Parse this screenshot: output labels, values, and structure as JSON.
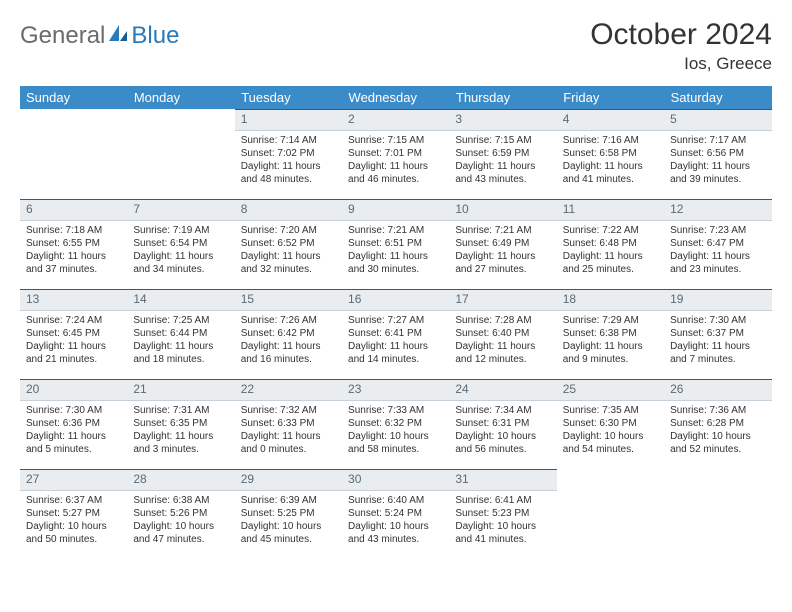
{
  "logo": {
    "part1": "General",
    "part2": "Blue"
  },
  "title": "October 2024",
  "location": "Ios, Greece",
  "dayHeaders": [
    "Sunday",
    "Monday",
    "Tuesday",
    "Wednesday",
    "Thursday",
    "Friday",
    "Saturday"
  ],
  "weeks": [
    [
      null,
      null,
      {
        "n": "1",
        "sr": "7:14 AM",
        "ss": "7:02 PM",
        "dl": "11 hours and 48 minutes."
      },
      {
        "n": "2",
        "sr": "7:15 AM",
        "ss": "7:01 PM",
        "dl": "11 hours and 46 minutes."
      },
      {
        "n": "3",
        "sr": "7:15 AM",
        "ss": "6:59 PM",
        "dl": "11 hours and 43 minutes."
      },
      {
        "n": "4",
        "sr": "7:16 AM",
        "ss": "6:58 PM",
        "dl": "11 hours and 41 minutes."
      },
      {
        "n": "5",
        "sr": "7:17 AM",
        "ss": "6:56 PM",
        "dl": "11 hours and 39 minutes."
      }
    ],
    [
      {
        "n": "6",
        "sr": "7:18 AM",
        "ss": "6:55 PM",
        "dl": "11 hours and 37 minutes."
      },
      {
        "n": "7",
        "sr": "7:19 AM",
        "ss": "6:54 PM",
        "dl": "11 hours and 34 minutes."
      },
      {
        "n": "8",
        "sr": "7:20 AM",
        "ss": "6:52 PM",
        "dl": "11 hours and 32 minutes."
      },
      {
        "n": "9",
        "sr": "7:21 AM",
        "ss": "6:51 PM",
        "dl": "11 hours and 30 minutes."
      },
      {
        "n": "10",
        "sr": "7:21 AM",
        "ss": "6:49 PM",
        "dl": "11 hours and 27 minutes."
      },
      {
        "n": "11",
        "sr": "7:22 AM",
        "ss": "6:48 PM",
        "dl": "11 hours and 25 minutes."
      },
      {
        "n": "12",
        "sr": "7:23 AM",
        "ss": "6:47 PM",
        "dl": "11 hours and 23 minutes."
      }
    ],
    [
      {
        "n": "13",
        "sr": "7:24 AM",
        "ss": "6:45 PM",
        "dl": "11 hours and 21 minutes."
      },
      {
        "n": "14",
        "sr": "7:25 AM",
        "ss": "6:44 PM",
        "dl": "11 hours and 18 minutes."
      },
      {
        "n": "15",
        "sr": "7:26 AM",
        "ss": "6:42 PM",
        "dl": "11 hours and 16 minutes."
      },
      {
        "n": "16",
        "sr": "7:27 AM",
        "ss": "6:41 PM",
        "dl": "11 hours and 14 minutes."
      },
      {
        "n": "17",
        "sr": "7:28 AM",
        "ss": "6:40 PM",
        "dl": "11 hours and 12 minutes."
      },
      {
        "n": "18",
        "sr": "7:29 AM",
        "ss": "6:38 PM",
        "dl": "11 hours and 9 minutes."
      },
      {
        "n": "19",
        "sr": "7:30 AM",
        "ss": "6:37 PM",
        "dl": "11 hours and 7 minutes."
      }
    ],
    [
      {
        "n": "20",
        "sr": "7:30 AM",
        "ss": "6:36 PM",
        "dl": "11 hours and 5 minutes."
      },
      {
        "n": "21",
        "sr": "7:31 AM",
        "ss": "6:35 PM",
        "dl": "11 hours and 3 minutes."
      },
      {
        "n": "22",
        "sr": "7:32 AM",
        "ss": "6:33 PM",
        "dl": "11 hours and 0 minutes."
      },
      {
        "n": "23",
        "sr": "7:33 AM",
        "ss": "6:32 PM",
        "dl": "10 hours and 58 minutes."
      },
      {
        "n": "24",
        "sr": "7:34 AM",
        "ss": "6:31 PM",
        "dl": "10 hours and 56 minutes."
      },
      {
        "n": "25",
        "sr": "7:35 AM",
        "ss": "6:30 PM",
        "dl": "10 hours and 54 minutes."
      },
      {
        "n": "26",
        "sr": "7:36 AM",
        "ss": "6:28 PM",
        "dl": "10 hours and 52 minutes."
      }
    ],
    [
      {
        "n": "27",
        "sr": "6:37 AM",
        "ss": "5:27 PM",
        "dl": "10 hours and 50 minutes."
      },
      {
        "n": "28",
        "sr": "6:38 AM",
        "ss": "5:26 PM",
        "dl": "10 hours and 47 minutes."
      },
      {
        "n": "29",
        "sr": "6:39 AM",
        "ss": "5:25 PM",
        "dl": "10 hours and 45 minutes."
      },
      {
        "n": "30",
        "sr": "6:40 AM",
        "ss": "5:24 PM",
        "dl": "10 hours and 43 minutes."
      },
      {
        "n": "31",
        "sr": "6:41 AM",
        "ss": "5:23 PM",
        "dl": "10 hours and 41 minutes."
      },
      null,
      null
    ]
  ],
  "labels": {
    "sunrise": "Sunrise:",
    "sunset": "Sunset:",
    "daylight": "Daylight:"
  }
}
